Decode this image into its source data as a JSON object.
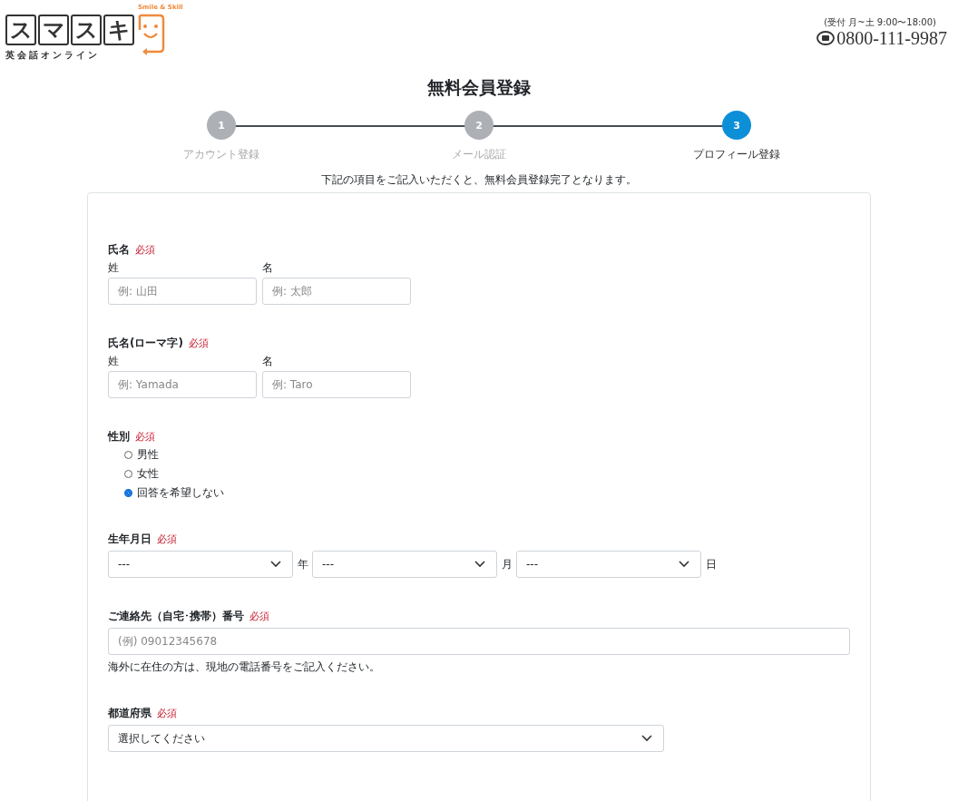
{
  "header": {
    "logo": {
      "tiles": [
        "ス",
        "マ",
        "ス",
        "キ"
      ],
      "subtitle": "英会話オンライン",
      "tagline": "Smile & Skill"
    },
    "hours": "(受付 月~土 9:00〜18:00)",
    "phone": "0800-111-9987"
  },
  "title": "無料会員登録",
  "steps": [
    {
      "number": "1",
      "label": "アカウント登録",
      "selected": false
    },
    {
      "number": "2",
      "label": "メール認証",
      "selected": false
    },
    {
      "number": "3",
      "label": "プロフィール登録",
      "selected": true
    }
  ],
  "intro": "下記の項目をご記入いただくと、無料会員登録完了となります。",
  "sections": [
    {
      "kind": "pair",
      "label": "氏名",
      "required": "必須",
      "fields": [
        {
          "label": "姓",
          "placeholder": "例: 山田"
        },
        {
          "label": "名",
          "placeholder": "例: 太郎"
        }
      ]
    },
    {
      "kind": "pair",
      "label": "氏名(ローマ字)",
      "required": "必須",
      "fields": [
        {
          "label": "姓",
          "placeholder": "例: Yamada"
        },
        {
          "label": "名",
          "placeholder": "例: Taro"
        }
      ]
    },
    {
      "kind": "radio",
      "label": "性別",
      "required": "必須",
      "options": [
        {
          "label": "男性",
          "selected": false
        },
        {
          "label": "女性",
          "selected": false
        },
        {
          "label": "回答を希望しない",
          "selected": true
        }
      ]
    },
    {
      "kind": "date",
      "label": "生年月日",
      "required": "必須",
      "selects": [
        {
          "value": "---",
          "unit": "年"
        },
        {
          "value": "---",
          "unit": "月"
        },
        {
          "value": "---",
          "unit": "日"
        }
      ]
    },
    {
      "kind": "text",
      "label": "ご連絡先（自宅･携帯）番号",
      "required": "必須",
      "placeholder": "(例) 09012345678",
      "note": "海外に在住の方は、現地の電話番号をご記入ください。"
    },
    {
      "kind": "select",
      "label": "都道府県",
      "required": "必須",
      "value": "選択してください"
    }
  ]
}
